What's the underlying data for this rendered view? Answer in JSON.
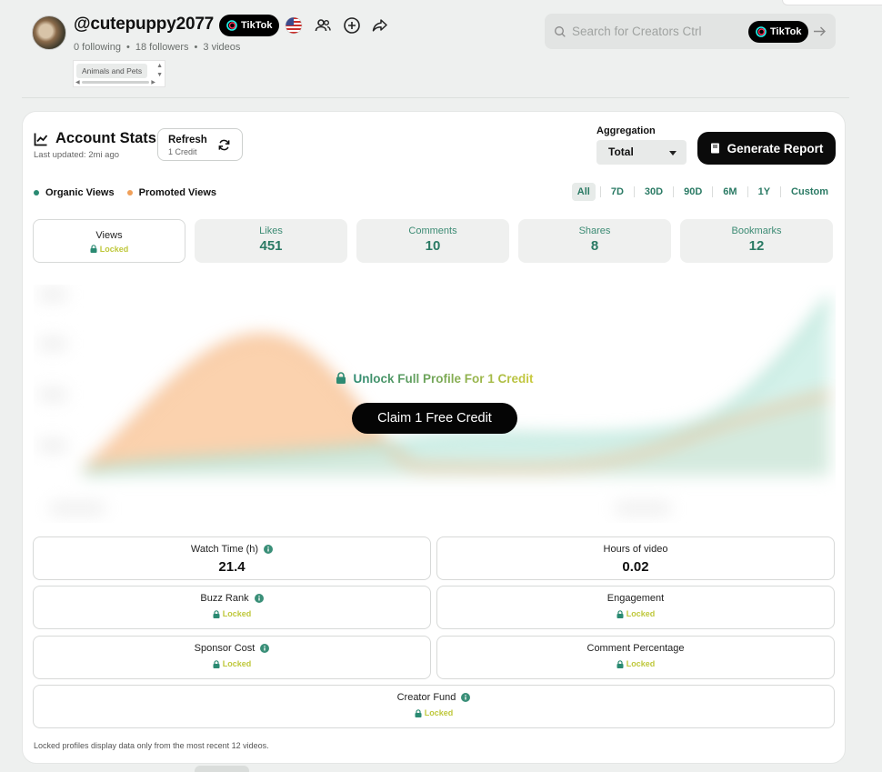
{
  "profile": {
    "handle": "@cutepuppy2077",
    "platform_badge": "TikTok",
    "following": "0 following",
    "followers": "18 followers",
    "videos": "3 videos",
    "category": "Animals and Pets"
  },
  "search": {
    "placeholder": "Search for Creators Ctrl",
    "platform_badge": "TikTok"
  },
  "stats": {
    "title": "Account Stats",
    "last_updated": "Last updated: 2mi ago",
    "refresh_label": "Refresh",
    "refresh_cost": "1 Credit",
    "aggregation_label": "Aggregation",
    "aggregation_value": "Total",
    "report_button": "Generate Report",
    "legend": [
      {
        "label": "Organic Views",
        "color": "#2a8a72"
      },
      {
        "label": "Promoted Views",
        "color": "#f0a05a"
      }
    ],
    "ranges": [
      "All",
      "7D",
      "30D",
      "90D",
      "6M",
      "1Y",
      "Custom"
    ],
    "active_range": "All",
    "tiles": [
      {
        "label": "Views",
        "value": "Locked"
      },
      {
        "label": "Likes",
        "value": "451"
      },
      {
        "label": "Comments",
        "value": "10"
      },
      {
        "label": "Shares",
        "value": "8"
      },
      {
        "label": "Bookmarks",
        "value": "12"
      }
    ],
    "unlock_text": "Unlock Full Profile For 1 Credit",
    "claim_button": "Claim 1 Free Credit",
    "metrics": {
      "watch_time": {
        "label": "Watch Time (h)",
        "value": "21.4"
      },
      "hours_of_video": {
        "label": "Hours of video",
        "value": "0.02"
      },
      "buzz_rank": {
        "label": "Buzz Rank",
        "value": "Locked"
      },
      "engagement": {
        "label": "Engagement",
        "value": "Locked"
      },
      "sponsor_cost": {
        "label": "Sponsor Cost",
        "value": "Locked"
      },
      "comment_percentage": {
        "label": "Comment Percentage",
        "value": "Locked"
      },
      "creator_fund": {
        "label": "Creator Fund",
        "value": "Locked"
      }
    },
    "footnote": "Locked profiles display data only from the most recent 12 videos."
  },
  "colors": {
    "accent_green": "#2a7a64",
    "locked_yellow": "#bfc83c",
    "organic": "#2a8a72",
    "promoted": "#f0a05a"
  }
}
